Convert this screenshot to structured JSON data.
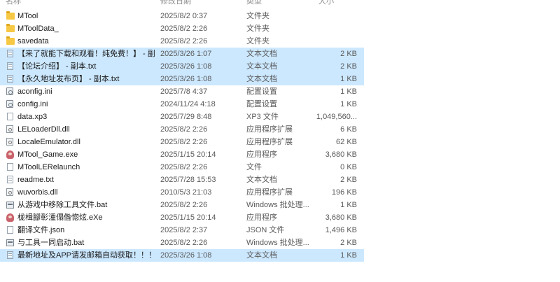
{
  "header": {
    "name": "名称",
    "date": "修改日期",
    "type": "类型",
    "size": "大小"
  },
  "files": [
    {
      "name": "MTool",
      "date": "2025/8/2 0:37",
      "type": "文件夹",
      "size": "",
      "icon": "folder-icon",
      "selected": false
    },
    {
      "name": "MToolData_",
      "date": "2025/8/2 2:26",
      "type": "文件夹",
      "size": "",
      "icon": "folder-icon",
      "selected": false
    },
    {
      "name": "savedata",
      "date": "2025/8/2 2:26",
      "type": "文件夹",
      "size": "",
      "icon": "folder-icon",
      "selected": false
    },
    {
      "name": "【来了就能下载和观看！纯免费！】 - 副...",
      "date": "2025/3/26 1:07",
      "type": "文本文档",
      "size": "2 KB",
      "icon": "text-file-icon",
      "selected": true
    },
    {
      "name": "【论坛介绍】 - 副本.txt",
      "date": "2025/3/26 1:08",
      "type": "文本文档",
      "size": "2 KB",
      "icon": "text-file-icon",
      "selected": true
    },
    {
      "name": "【永久地址发布页】 - 副本.txt",
      "date": "2025/3/26 1:08",
      "type": "文本文档",
      "size": "1 KB",
      "icon": "text-file-icon",
      "selected": true
    },
    {
      "name": "aconfig.ini",
      "date": "2025/7/8 4:37",
      "type": "配置设置",
      "size": "1 KB",
      "icon": "config-file-icon",
      "selected": false
    },
    {
      "name": "config.ini",
      "date": "2024/11/24 4:18",
      "type": "配置设置",
      "size": "1 KB",
      "icon": "config-file-icon",
      "selected": false
    },
    {
      "name": "data.xp3",
      "date": "2025/7/29 8:48",
      "type": "XP3 文件",
      "size": "1,049,560...",
      "icon": "blank-file-icon",
      "selected": false
    },
    {
      "name": "LELoaderDll.dll",
      "date": "2025/8/2 2:26",
      "type": "应用程序扩展",
      "size": "6 KB",
      "icon": "dll-file-icon",
      "selected": false
    },
    {
      "name": "LocaleEmulator.dll",
      "date": "2025/8/2 2:26",
      "type": "应用程序扩展",
      "size": "62 KB",
      "icon": "dll-file-icon",
      "selected": false
    },
    {
      "name": "MTool_Game.exe",
      "date": "2025/1/15 20:14",
      "type": "应用程序",
      "size": "3,680 KB",
      "icon": "exe-file-icon",
      "selected": false
    },
    {
      "name": "MToolLERelaunch",
      "date": "2025/8/2 2:26",
      "type": "文件",
      "size": "0 KB",
      "icon": "blank-file-icon",
      "selected": false
    },
    {
      "name": "readme.txt",
      "date": "2025/7/28 15:53",
      "type": "文本文档",
      "size": "2 KB",
      "icon": "text-file-icon",
      "selected": false
    },
    {
      "name": "wuvorbis.dll",
      "date": "2010/5/3 21:03",
      "type": "应用程序扩展",
      "size": "196 KB",
      "icon": "dll-file-icon",
      "selected": false
    },
    {
      "name": "从游戏中移除工具文件.bat",
      "date": "2025/8/2 2:26",
      "type": "Windows 批处理...",
      "size": "1 KB",
      "icon": "batch-file-icon",
      "selected": false
    },
    {
      "name": "栊楫腳彰湩傝偺惚炫.eXe",
      "date": "2025/1/15 20:14",
      "type": "应用程序",
      "size": "3,680 KB",
      "icon": "exe-file-icon",
      "selected": false
    },
    {
      "name": "翻译文件.json",
      "date": "2025/8/2 2:37",
      "type": "JSON 文件",
      "size": "1,496 KB",
      "icon": "blank-file-icon",
      "selected": false
    },
    {
      "name": "与工具一同启动.bat",
      "date": "2025/8/2 2:26",
      "type": "Windows 批处理...",
      "size": "2 KB",
      "icon": "batch-file-icon",
      "selected": false
    },
    {
      "name": "最新地址及APP请发邮箱自动获取！！！...",
      "date": "2025/3/26 1:08",
      "type": "文本文档",
      "size": "1 KB",
      "icon": "text-file-icon",
      "selected": true
    }
  ]
}
